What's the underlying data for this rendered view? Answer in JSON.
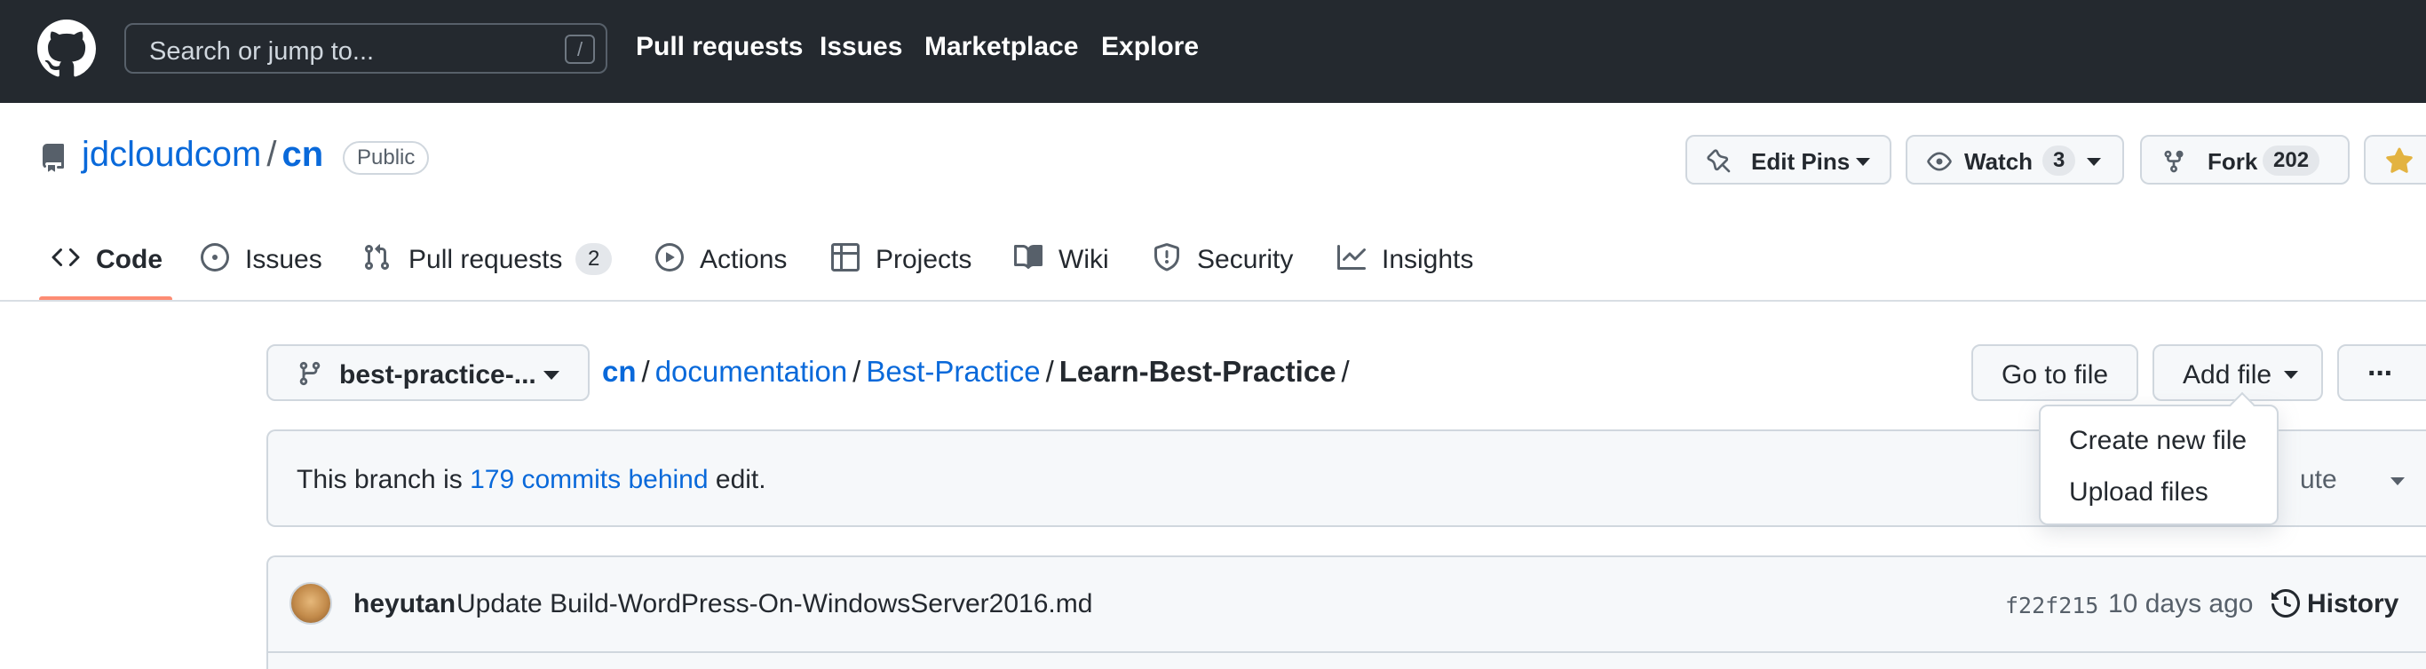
{
  "header": {
    "search_placeholder": "Search or jump to...",
    "search_shortcut": "/",
    "nav": [
      "Pull requests",
      "Issues",
      "Marketplace",
      "Explore"
    ]
  },
  "repo": {
    "owner": "jdcloudcom",
    "separator": "/",
    "name": "cn",
    "visibility": "Public",
    "actions": {
      "edit_pins": "Edit Pins",
      "watch": "Watch",
      "watch_count": "3",
      "fork": "Fork",
      "fork_count": "202"
    }
  },
  "tabs": [
    {
      "label": "Code",
      "icon": "code-icon",
      "active": true
    },
    {
      "label": "Issues",
      "icon": "issue-icon"
    },
    {
      "label": "Pull requests",
      "icon": "pull-request-icon",
      "count": "2"
    },
    {
      "label": "Actions",
      "icon": "play-icon"
    },
    {
      "label": "Projects",
      "icon": "table-icon"
    },
    {
      "label": "Wiki",
      "icon": "book-icon"
    },
    {
      "label": "Security",
      "icon": "shield-icon"
    },
    {
      "label": "Insights",
      "icon": "graph-icon"
    }
  ],
  "file_nav": {
    "branch": "best-practice-...",
    "breadcrumb": [
      "cn",
      "documentation",
      "Best-Practice"
    ],
    "current": "Learn-Best-Practice",
    "sep": "/",
    "go_to_file": "Go to file",
    "add_file": "Add file",
    "more": "···"
  },
  "add_file_menu": [
    "Create new file",
    "Upload files"
  ],
  "branch_info": {
    "prefix": "This branch is ",
    "link": "179 commits behind",
    "suffix": " edit.",
    "contribute_partial": "ute"
  },
  "commit": {
    "author": "heyutan",
    "message": "Update Build-WordPress-On-WindowsServer2016.md",
    "sha": "f22f215",
    "time": "10 days ago",
    "history": "History"
  },
  "colors": {
    "header_bg": "#24292f",
    "link": "#0969da",
    "active_tab_underline": "#fd8c73",
    "star": "#e3b341"
  }
}
